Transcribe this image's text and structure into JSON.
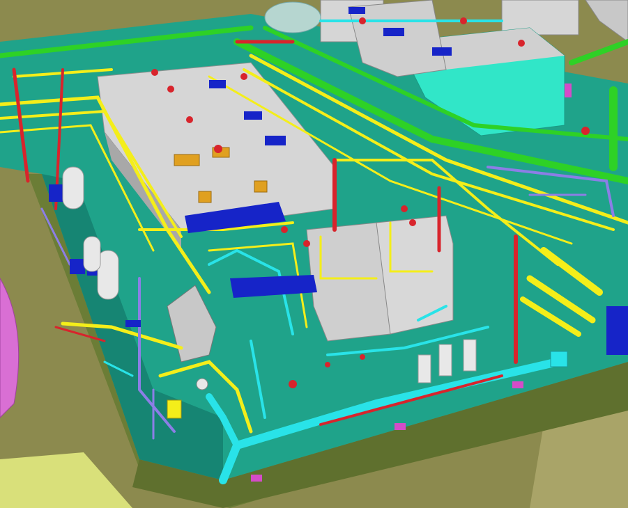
{
  "scene": {
    "palette": {
      "ground": "#8c8a4e",
      "ground_light": "#a9a468",
      "deck": "#1fa38a",
      "deck_dark": "#168573",
      "deck_side": "#6b7d36",
      "pipe_yellow": "#f4ee1a",
      "pipe_green": "#2ed126",
      "pipe_cyan": "#29e3e8",
      "pipe_red": "#d8242c",
      "pipe_purple": "#8c7ee6",
      "equip_gray": "#d6d6d6",
      "equip_cyan": "#31e6c8",
      "blue_panel": "#1624c8",
      "orange_box": "#e0a020",
      "magenta": "#d44cc8",
      "pink_tank": "#d96fd4"
    },
    "icons": [
      "valve-icon",
      "pump-icon",
      "tank-icon",
      "support-icon"
    ]
  }
}
